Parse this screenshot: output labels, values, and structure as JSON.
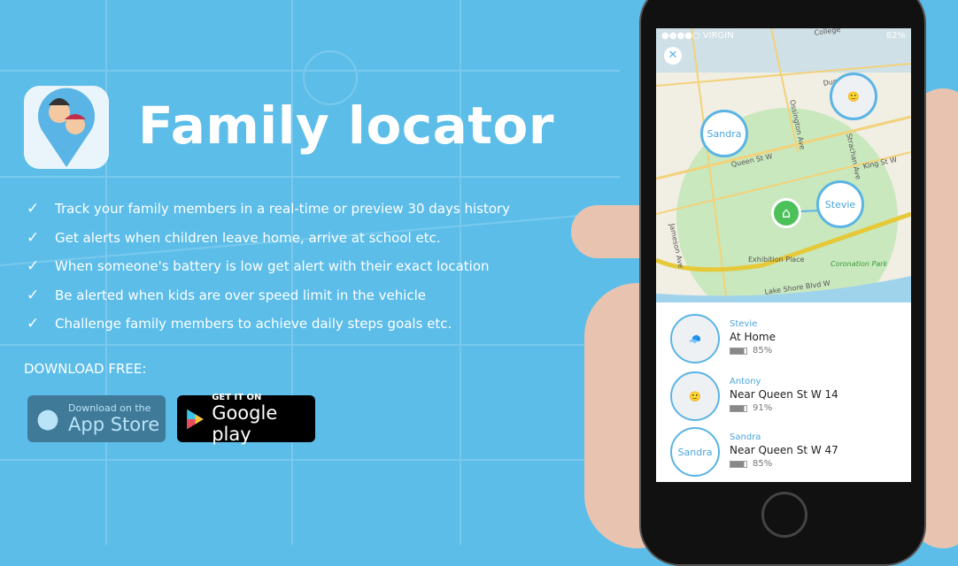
{
  "title": "Family locator",
  "features": [
    "Track your family members in a real-time or preview 30 days history",
    "Get alerts when children leave home, arrive at school etc.",
    "When someone's battery is low get alert with their exact location",
    "Be alerted when kids are over speed limit in the vehicle",
    "Challenge family members to achieve daily steps goals etc."
  ],
  "download_label": "DOWNLOAD FREE:",
  "app_store": {
    "small": "Download on the",
    "big": "App Store"
  },
  "google_play": {
    "small": "GET IT ON",
    "big": "Google play"
  },
  "phone": {
    "status": {
      "carrier": "●●●●○ VIRGIN",
      "battery": "82%"
    },
    "map_labels": [
      "Queen St W",
      "King St W",
      "Ossington Ave",
      "Strachan Ave",
      "Jameson Ave",
      "Exhibition Place",
      "Coronation Park",
      "Lake Shore Blvd W",
      "Dundas",
      "College"
    ],
    "pins": {
      "sandra": "Sandra",
      "stevie": "Stevie"
    },
    "members": [
      {
        "name": "Stevie",
        "location": "At Home",
        "battery": "85%"
      },
      {
        "name": "Antony",
        "location": "Near Queen St W 14",
        "battery": "91%"
      },
      {
        "name": "Sandra",
        "location": "Near Queen St W 47",
        "battery": "85%",
        "avatar_text": "Sandra"
      }
    ]
  },
  "colors": {
    "background": "#5cbde9",
    "accent": "#5ab4e5",
    "home": "#4cc15a"
  }
}
